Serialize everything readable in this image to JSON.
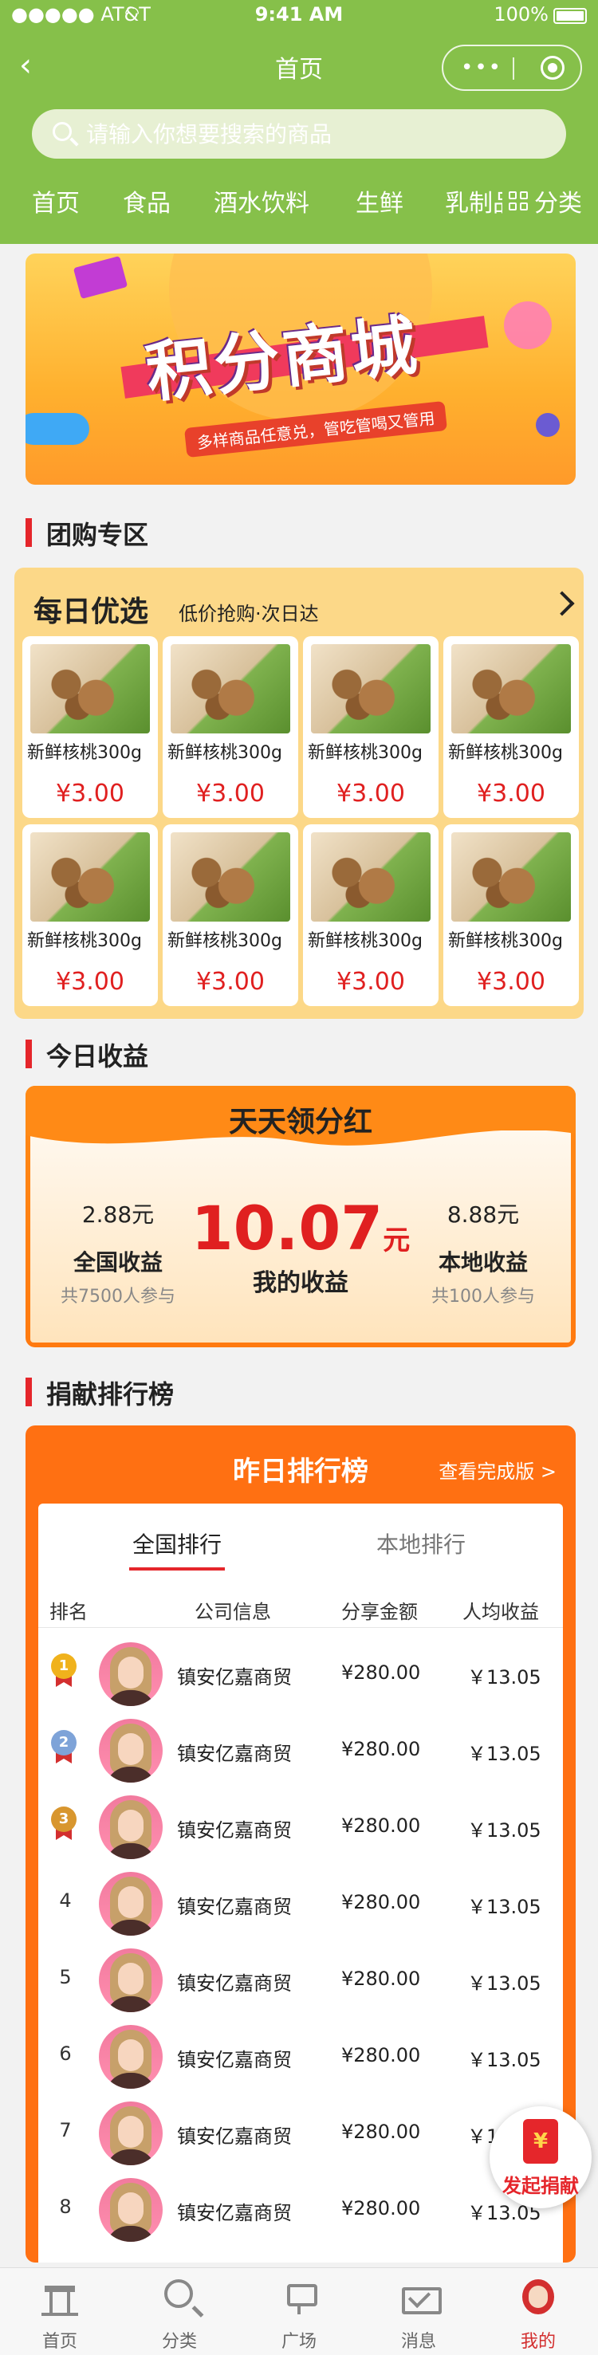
{
  "status_bar": {
    "carrier": "●●●●● AT&T",
    "time": "9:41 AM",
    "battery": "100%"
  },
  "navbar": {
    "title": "首页",
    "back_icon": "chevron-left-icon",
    "capsule_dots": "•••"
  },
  "search": {
    "placeholder": "请输入你想要搜索的商品"
  },
  "categories": [
    "首页",
    "食品",
    "酒水饮料",
    "生鲜",
    "乳制品"
  ],
  "category_all": "分类",
  "banner": {
    "title": "积分商城",
    "subtitle": "多样商品任意兑，管吃管喝又管用"
  },
  "group_section": {
    "title": "团购专区",
    "daily_title": "每日优选",
    "daily_sub": "低价抢购·次日达",
    "products": [
      {
        "name": "新鲜核桃300g",
        "price": "¥3.00"
      },
      {
        "name": "新鲜核桃300g",
        "price": "¥3.00"
      },
      {
        "name": "新鲜核桃300g",
        "price": "¥3.00"
      },
      {
        "name": "新鲜核桃300g",
        "price": "¥3.00"
      },
      {
        "name": "新鲜核桃300g",
        "price": "¥3.00"
      },
      {
        "name": "新鲜核桃300g",
        "price": "¥3.00"
      },
      {
        "name": "新鲜核桃300g",
        "price": "¥3.00"
      },
      {
        "name": "新鲜核桃300g",
        "price": "¥3.00"
      }
    ]
  },
  "earnings": {
    "section_title": "今日收益",
    "header": "天天领分红",
    "national": {
      "value": "2.88元",
      "label": "全国收益",
      "participants": "共7500人参与"
    },
    "mine": {
      "value": "10.07",
      "unit": "元",
      "label": "我的收益"
    },
    "local": {
      "value": "8.88元",
      "label": "本地收益",
      "participants": "共100人参与"
    }
  },
  "ranking": {
    "section_title": "捐献排行榜",
    "board_title": "昨日排行榜",
    "view_full": "查看完成版 >",
    "tabs": [
      "全国排行",
      "本地排行"
    ],
    "columns": [
      "排名",
      "公司信息",
      "分享金额",
      "人均收益"
    ],
    "rows": [
      {
        "rank": "1",
        "company": "镇安亿嘉商贸",
        "amount": "¥280.00",
        "avg": "￥13.05"
      },
      {
        "rank": "2",
        "company": "镇安亿嘉商贸",
        "amount": "¥280.00",
        "avg": "￥13.05"
      },
      {
        "rank": "3",
        "company": "镇安亿嘉商贸",
        "amount": "¥280.00",
        "avg": "￥13.05"
      },
      {
        "rank": "4",
        "company": "镇安亿嘉商贸",
        "amount": "¥280.00",
        "avg": "￥13.05"
      },
      {
        "rank": "5",
        "company": "镇安亿嘉商贸",
        "amount": "¥280.00",
        "avg": "￥13.05"
      },
      {
        "rank": "6",
        "company": "镇安亿嘉商贸",
        "amount": "¥280.00",
        "avg": "￥13.05"
      },
      {
        "rank": "7",
        "company": "镇安亿嘉商贸",
        "amount": "¥280.00",
        "avg": "￥13.05"
      },
      {
        "rank": "8",
        "company": "镇安亿嘉商贸",
        "amount": "¥280.00",
        "avg": "￥13.05"
      }
    ],
    "medal_colors": [
      "#f0b21c",
      "#7ea3d8",
      "#d8962e"
    ]
  },
  "float_button": {
    "symbol": "¥",
    "label": "发起捐献"
  },
  "tabbar": [
    {
      "label": "首页",
      "icon": "home-icon"
    },
    {
      "label": "分类",
      "icon": "search-icon"
    },
    {
      "label": "广场",
      "icon": "plaza-icon"
    },
    {
      "label": "消息",
      "icon": "message-icon"
    },
    {
      "label": "我的",
      "icon": "profile-icon"
    }
  ],
  "colors": {
    "brand_green": "#86c04a",
    "accent_orange": "#ff7012",
    "price_red": "#e02020"
  }
}
